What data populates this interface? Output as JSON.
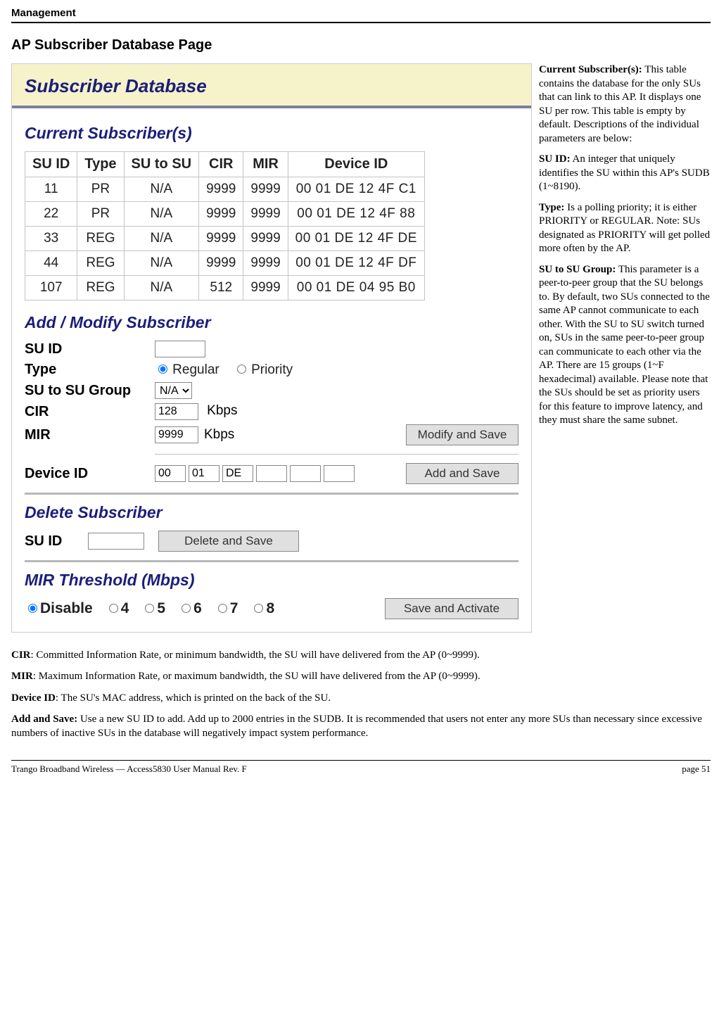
{
  "header": {
    "section": "Management"
  },
  "heading": "AP Subscriber Database Page",
  "screenshot": {
    "panel_title": "Subscriber Database",
    "current": {
      "title": "Current Subscriber(s)",
      "columns": [
        "SU ID",
        "Type",
        "SU to SU",
        "CIR",
        "MIR",
        "Device ID"
      ],
      "rows": [
        {
          "su_id": "11",
          "type": "PR",
          "su2su": "N/A",
          "cir": "9999",
          "mir": "9999",
          "dev": "00 01 DE 12 4F C1"
        },
        {
          "su_id": "22",
          "type": "PR",
          "su2su": "N/A",
          "cir": "9999",
          "mir": "9999",
          "dev": "00 01 DE 12 4F 88"
        },
        {
          "su_id": "33",
          "type": "REG",
          "su2su": "N/A",
          "cir": "9999",
          "mir": "9999",
          "dev": "00 01 DE 12 4F DE"
        },
        {
          "su_id": "44",
          "type": "REG",
          "su2su": "N/A",
          "cir": "9999",
          "mir": "9999",
          "dev": "00 01 DE 12 4F DF"
        },
        {
          "su_id": "107",
          "type": "REG",
          "su2su": "N/A",
          "cir": "512",
          "mir": "9999",
          "dev": "00 01 DE 04 95 B0"
        }
      ]
    },
    "addmod": {
      "title": "Add / Modify Subscriber",
      "labels": {
        "su_id": "SU ID",
        "type": "Type",
        "su2su": "SU to SU Group",
        "cir": "CIR",
        "mir": "MIR",
        "device_id": "Device ID"
      },
      "type_options": {
        "regular": "Regular",
        "priority": "Priority"
      },
      "su2su_value": "N/A",
      "cir_value": "128",
      "mir_value": "9999",
      "kbps": "Kbps",
      "dev_values": [
        "00",
        "01",
        "DE",
        "",
        "",
        ""
      ],
      "modify_btn": "Modify and Save",
      "add_btn": "Add and Save"
    },
    "del": {
      "title": "Delete Subscriber",
      "label": "SU ID",
      "btn": "Delete and Save"
    },
    "mir_thresh": {
      "title": "MIR Threshold (Mbps)",
      "options": [
        "Disable",
        "4",
        "5",
        "6",
        "7",
        "8"
      ],
      "btn": "Save and Activate"
    }
  },
  "sidecol": {
    "p1": {
      "term": "Current Subscriber(s):",
      "text": "  This table contains the database for the only SUs that can link to this AP.  It displays one SU per row.  This table is empty by default.  Descriptions of the individual parameters are below:"
    },
    "p2": {
      "term": "SU ID:",
      "text": "  An integer that uniquely identifies the SU within this AP's SUDB (1~8190)."
    },
    "p3": {
      "term": "Type:",
      "text": "  Is a polling priority; it is either PRIORITY or REGULAR.  Note:  SUs designated as PRIORITY will get polled more often by the AP."
    },
    "p4": {
      "term": "SU to SU Group:",
      "text": "  This parameter is a peer-to-peer group that the SU belongs to.  By default, two SUs connected to the same AP cannot communicate to each other.  With the SU to SU switch turned on, SUs in the same peer-to-peer group can communicate to each other via the AP.  There are 15 groups (1~F hexadecimal) available.  Please note that the SUs should be set as priority users for this feature to improve latency, and they must share the same subnet."
    }
  },
  "below": {
    "p1": {
      "term": "CIR",
      "text": ": Committed Information Rate, or minimum bandwidth, the SU will have delivered from the AP (0~9999)."
    },
    "p2": {
      "term": "MIR",
      "text": ": Maximum Information Rate, or maximum bandwidth, the SU will have delivered from the AP (0~9999)."
    },
    "p3": {
      "term": "Device ID",
      "text": ": The SU's MAC address, which is printed on the back of the SU."
    },
    "p4": {
      "term": "Add and Save:",
      "text": "  Use a new SU ID to add.  Add up to 2000 entries in the SUDB.  It is recommended that users not enter any more SUs than necessary since excessive numbers of inactive SUs in the database will negatively impact system performance."
    }
  },
  "footer": {
    "left": "Trango Broadband Wireless — Access5830 User Manual  Rev. F",
    "right": "page 51"
  }
}
